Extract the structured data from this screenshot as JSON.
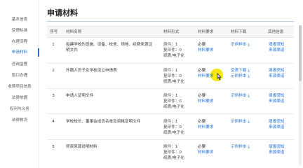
{
  "sidebar": {
    "items": [
      {
        "label": "基本信息"
      },
      {
        "label": "受理标准"
      },
      {
        "label": "办理流程"
      },
      {
        "label": "申请材料"
      },
      {
        "label": "咨询监督"
      },
      {
        "label": "窗口办理"
      },
      {
        "label": "收费项目信息"
      },
      {
        "label": "法律依据"
      },
      {
        "label": "权利与义务"
      },
      {
        "label": "法律救济"
      }
    ],
    "active_index": 3
  },
  "page": {
    "title": "申请材料"
  },
  "table": {
    "headers": {
      "seq": "序号",
      "name": "材料名称",
      "form": "材料形式",
      "required": "材料要求",
      "download": "材料下载",
      "other": "其他信息"
    },
    "rows": [
      {
        "seq": "1",
        "name": "拟建学校的设施、设备、校舍、场地、经费来源证明文件",
        "original": "原件：1",
        "copy": "复印件：0",
        "paper": "纸质/电子化",
        "req": "必要",
        "req_note": "材料要求",
        "download": "示例样本",
        "info1": "填报须知",
        "info2": "来源渠道"
      },
      {
        "seq": "2",
        "name": "外籍人员子女学校设立申请表",
        "original": "原件：1",
        "copy": "复印件：0",
        "paper": "纸质/电子化",
        "req": "必要",
        "req_note": "材料要求",
        "download": "空表下载",
        "download2": "示例样本",
        "info1": "填报须知",
        "info2": "来源渠道"
      },
      {
        "seq": "3",
        "name": "申请人证明文件",
        "original": "原件：1",
        "copy": "复印件：0",
        "paper": "纸质/电子化",
        "req": "必要",
        "req_note": "材料要求",
        "download": "示例样本",
        "info1": "填报须知",
        "info2": "来源渠道"
      },
      {
        "seq": "4",
        "name": "学校校长、董事会成员名单及资格证明文件",
        "original": "原件：1",
        "copy": "复印件：0",
        "paper": "纸质/电子化",
        "req": "必要",
        "req_note": "材料要求",
        "download": "示例样本",
        "info1": "填报须知",
        "info2": "来源渠道"
      },
      {
        "seq": "5",
        "name": "师资来源说明材料",
        "original": "原件：1",
        "copy": "复印件：0",
        "paper": "纸质/电子化",
        "req": "必要",
        "req_note": "材料要求",
        "download": "示例样本",
        "info1": "填报须知",
        "info2": "来源渠道"
      }
    ]
  },
  "colors": {
    "accent": "#1e6fd9",
    "cursor_highlight": "#f5e600"
  }
}
